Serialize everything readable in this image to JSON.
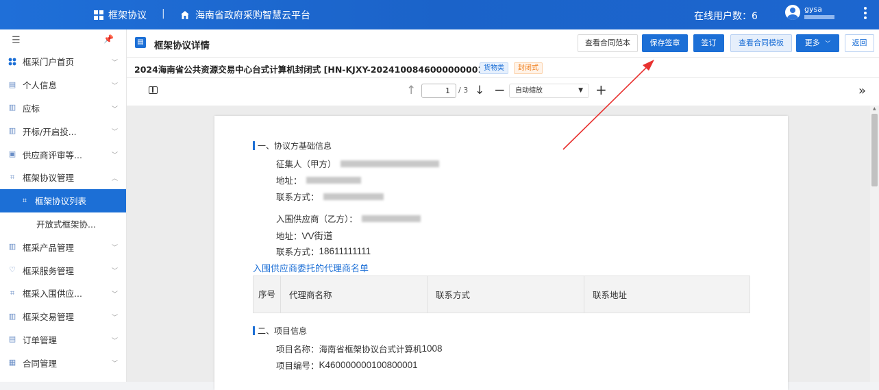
{
  "topbar": {
    "brand": "框架协议",
    "separator": "|",
    "platform": "海南省政府采购智慧云平台",
    "online_label": "在线用户数：",
    "online_count": "6",
    "username": "gysa"
  },
  "sidebar": {
    "items": [
      {
        "label": "框采门户首页",
        "icon": "grid-icon"
      },
      {
        "label": "个人信息",
        "icon": "id-card-icon"
      },
      {
        "label": "应标",
        "icon": "doc-icon"
      },
      {
        "label": "开标/开启投...",
        "icon": "doc-icon"
      },
      {
        "label": "供应商评审等...",
        "icon": "monitor-icon"
      },
      {
        "label": "框架协议管理",
        "icon": "agreement-icon"
      },
      {
        "label": "框架协议列表",
        "icon": "agreement-icon",
        "active": true
      },
      {
        "label": "开放式框架协...",
        "sub": true
      },
      {
        "label": "框采产品管理",
        "icon": "doc-icon"
      },
      {
        "label": "框采服务管理",
        "icon": "service-icon"
      },
      {
        "label": "框采入围供应...",
        "icon": "supplier-icon"
      },
      {
        "label": "框采交易管理",
        "icon": "doc-icon"
      },
      {
        "label": "订单管理",
        "icon": "order-icon"
      },
      {
        "label": "合同管理",
        "icon": "contract-icon"
      }
    ]
  },
  "header": {
    "title": "框架协议详情",
    "buttons": {
      "view_sample": "查看合同范本",
      "save_sign": "保存签章",
      "sign": "签订",
      "view_template": "查看合同模板",
      "more": "更多",
      "back": "返回"
    }
  },
  "project": {
    "title": "2024海南省公共资源交易中心台式计算机封闭式",
    "code": "[HN-KJXY-20241008460000000019]",
    "tag_goods": "货物类",
    "tag_closed": "封闭式"
  },
  "pdf_toolbar": {
    "page": "1",
    "total": "/ 3",
    "zoom": "自动缩放",
    "minus": "−",
    "plus": "+",
    "more": "»"
  },
  "document": {
    "section1": "一、协议方基础信息",
    "party_a_label": "征集人（甲方）",
    "address_label": "地址：",
    "contact_label": "联系方式：",
    "party_b_label": "入围供应商（乙方）：",
    "party_b_address_label": "地址：",
    "party_b_address_value": "VV街道",
    "party_b_contact_label": "联系方式：",
    "party_b_contact_value": "18611111111",
    "agent_list_title": "入围供应商委托的代理商名单",
    "agent_table": {
      "headers": [
        "序号",
        "代理商名称",
        "联系方式",
        "联系地址"
      ]
    },
    "section2": "二、项目信息",
    "project_name_label": "项目名称：海南省框架协议台式计算机",
    "project_name_value": "1008",
    "project_no_label": "项目编号：",
    "project_no_value": "K460000000100800001"
  }
}
